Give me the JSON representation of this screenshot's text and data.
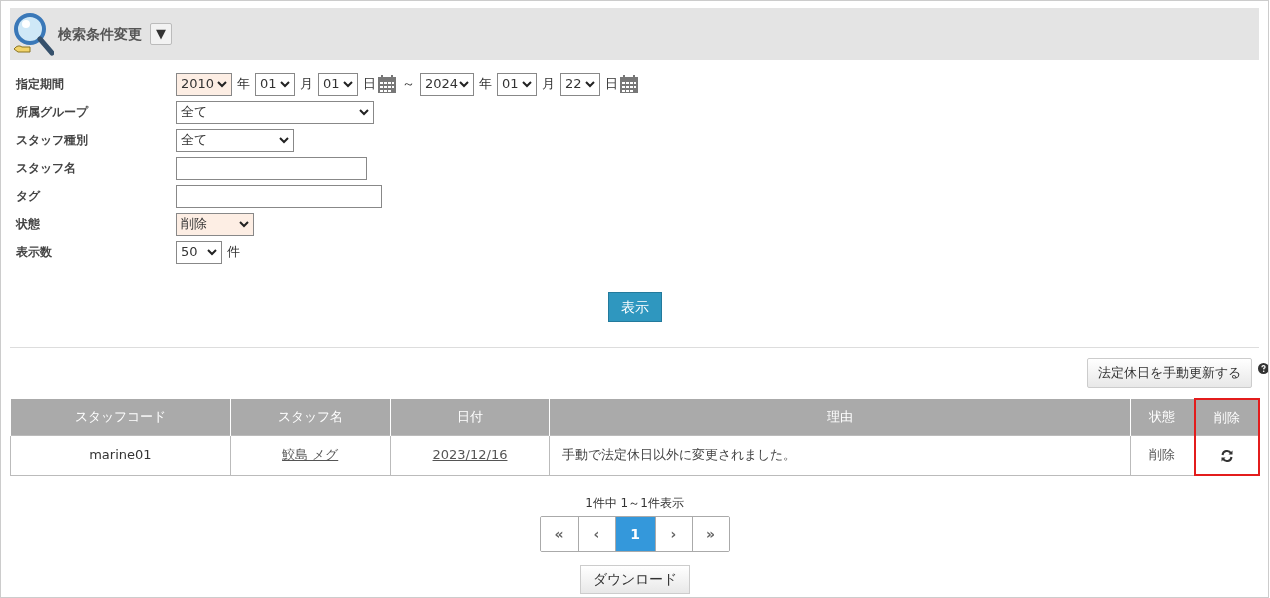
{
  "search_panel": {
    "title": "検索条件変更",
    "toggle": "▼"
  },
  "filters": [
    {
      "label": "指定期間",
      "items": [
        {
          "kind": "select",
          "value": "2010",
          "highlighted": true
        },
        {
          "kind": "unit",
          "text": "年"
        },
        {
          "kind": "select",
          "value": "01",
          "highlighted": false
        },
        {
          "kind": "unit",
          "text": "月"
        },
        {
          "kind": "select",
          "value": "01",
          "highlighted": false
        },
        {
          "kind": "unit",
          "text": "日"
        },
        {
          "kind": "calendar"
        },
        {
          "kind": "unit",
          "text": "～"
        },
        {
          "kind": "select",
          "value": "2024",
          "highlighted": false
        },
        {
          "kind": "unit",
          "text": "年"
        },
        {
          "kind": "select",
          "value": "01",
          "highlighted": false
        },
        {
          "kind": "unit",
          "text": "月"
        },
        {
          "kind": "select",
          "value": "22",
          "highlighted": false
        },
        {
          "kind": "unit",
          "text": "日"
        },
        {
          "kind": "calendar"
        }
      ]
    },
    {
      "label": "所属グループ",
      "items": [
        {
          "kind": "select",
          "value": "全て",
          "highlighted": false
        }
      ]
    },
    {
      "label": "スタッフ種別",
      "items": [
        {
          "kind": "select",
          "value": "全て",
          "highlighted": false
        }
      ]
    },
    {
      "label": "スタッフ名",
      "items": [
        {
          "kind": "text_input"
        }
      ]
    },
    {
      "label": "タグ",
      "items": [
        {
          "kind": "text_input"
        }
      ]
    },
    {
      "label": "状態",
      "items": [
        {
          "kind": "select",
          "value": "削除",
          "highlighted": true
        }
      ]
    },
    {
      "label": "表示数",
      "items": [
        {
          "kind": "select",
          "value": "50",
          "highlighted": false
        },
        {
          "kind": "unit",
          "text": "件"
        }
      ]
    }
  ],
  "submit_button": "表示",
  "update_button": "法定休日を手動更新する",
  "table": {
    "columns": [
      {
        "label": "スタッフコード",
        "outlined": false
      },
      {
        "label": "スタッフ名",
        "outlined": false
      },
      {
        "label": "日付",
        "outlined": false
      },
      {
        "label": "理由",
        "outlined": false
      },
      {
        "label": "状態",
        "outlined": false
      },
      {
        "label": "削除",
        "outlined": true
      }
    ],
    "rows": [
      {
        "staff_code": "marine01",
        "staff_name": "鮫島 メグ",
        "date": "2023/12/16",
        "reason": "手動で法定休日以外に変更されました。",
        "status": "削除"
      }
    ]
  },
  "pagination": {
    "summary": "1件中 1～1件表示",
    "pages": [
      {
        "label": "«",
        "selected": false
      },
      {
        "label": "‹",
        "selected": false
      },
      {
        "label": "1",
        "selected": true
      },
      {
        "label": "›",
        "selected": false
      },
      {
        "label": "»",
        "selected": false
      }
    ]
  },
  "download_button": "ダウンロード"
}
